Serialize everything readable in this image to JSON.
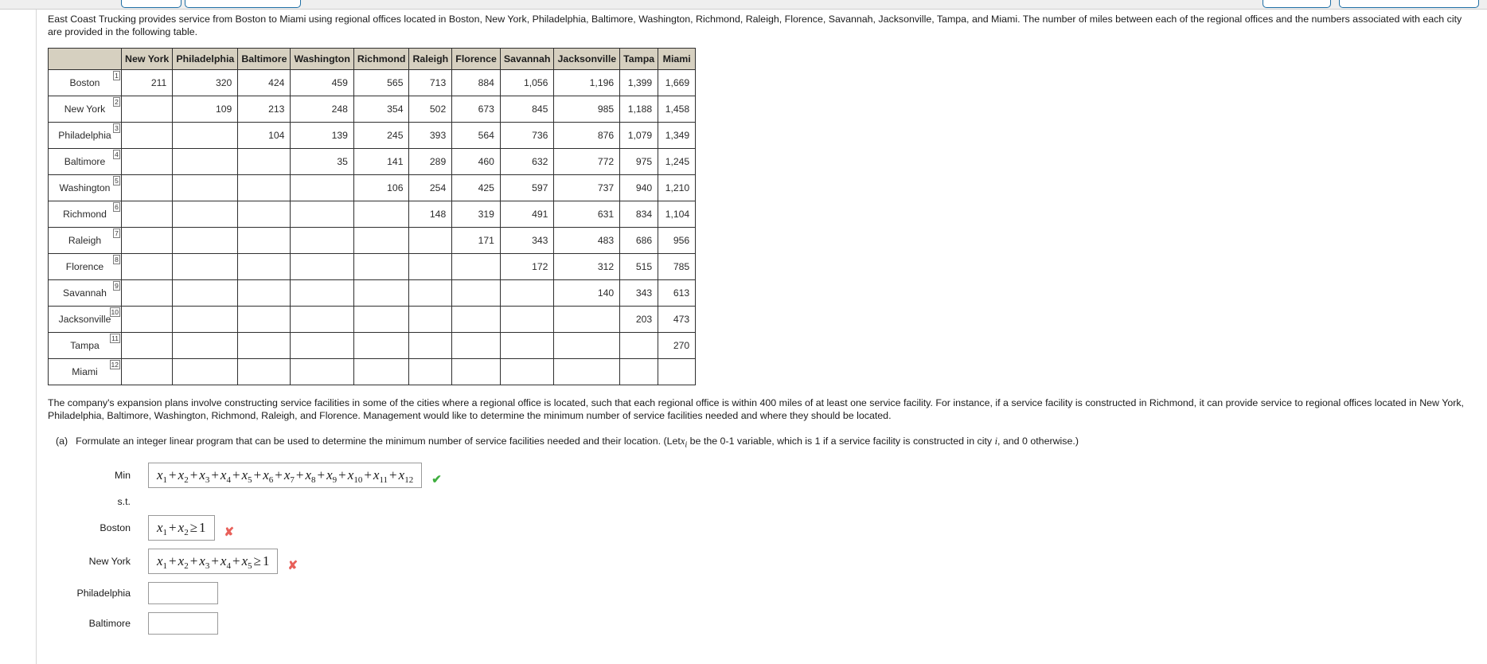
{
  "top_bar": {
    "buttons": [
      {
        "name": "toolbar-button-1",
        "label": ""
      },
      {
        "name": "toolbar-button-2",
        "label": ""
      },
      {
        "name": "toolbar-button-3",
        "label": ""
      },
      {
        "name": "toolbar-button-4",
        "label": ""
      }
    ]
  },
  "intro": {
    "paragraph": "East Coast Trucking provides service from Boston to Miami using regional offices located in Boston, New York, Philadelphia, Baltimore, Washington, Richmond, Raleigh, Florence, Savannah, Jacksonville, Tampa, and Miami. The number of miles between each of the regional offices and the numbers associated with each city are provided in the following table."
  },
  "table": {
    "corner_header": "",
    "columns": [
      "New York",
      "Philadelphia",
      "Baltimore",
      "Washington",
      "Richmond",
      "Raleigh",
      "Florence",
      "Savannah",
      "Jacksonville",
      "Tampa",
      "Miami"
    ],
    "rows": [
      {
        "city": "Boston",
        "index": "1",
        "values": [
          "211",
          "320",
          "424",
          "459",
          "565",
          "713",
          "884",
          "1,056",
          "1,196",
          "1,399",
          "1,669"
        ]
      },
      {
        "city": "New York",
        "index": "2",
        "values": [
          "",
          "109",
          "213",
          "248",
          "354",
          "502",
          "673",
          "845",
          "985",
          "1,188",
          "1,458"
        ]
      },
      {
        "city": "Philadelphia",
        "index": "3",
        "values": [
          "",
          "",
          "104",
          "139",
          "245",
          "393",
          "564",
          "736",
          "876",
          "1,079",
          "1,349"
        ]
      },
      {
        "city": "Baltimore",
        "index": "4",
        "values": [
          "",
          "",
          "",
          "35",
          "141",
          "289",
          "460",
          "632",
          "772",
          "975",
          "1,245"
        ]
      },
      {
        "city": "Washington",
        "index": "5",
        "values": [
          "",
          "",
          "",
          "",
          "106",
          "254",
          "425",
          "597",
          "737",
          "940",
          "1,210"
        ]
      },
      {
        "city": "Richmond",
        "index": "6",
        "values": [
          "",
          "",
          "",
          "",
          "",
          "148",
          "319",
          "491",
          "631",
          "834",
          "1,104"
        ]
      },
      {
        "city": "Raleigh",
        "index": "7",
        "values": [
          "",
          "",
          "",
          "",
          "",
          "",
          "171",
          "343",
          "483",
          "686",
          "956"
        ]
      },
      {
        "city": "Florence",
        "index": "8",
        "values": [
          "",
          "",
          "",
          "",
          "",
          "",
          "",
          "172",
          "312",
          "515",
          "785"
        ]
      },
      {
        "city": "Savannah",
        "index": "9",
        "values": [
          "",
          "",
          "",
          "",
          "",
          "",
          "",
          "",
          "140",
          "343",
          "613"
        ]
      },
      {
        "city": "Jacksonville",
        "index": "10",
        "values": [
          "",
          "",
          "",
          "",
          "",
          "",
          "",
          "",
          "",
          "203",
          "473"
        ]
      },
      {
        "city": "Tampa",
        "index": "11",
        "values": [
          "",
          "",
          "",
          "",
          "",
          "",
          "",
          "",
          "",
          "",
          "270"
        ]
      },
      {
        "city": "Miami",
        "index": "12",
        "values": [
          "",
          "",
          "",
          "",
          "",
          "",
          "",
          "",
          "",
          "",
          ""
        ]
      }
    ]
  },
  "expansion": {
    "paragraph": "The company's expansion plans involve constructing service facilities in some of the cities where a regional office is located, such that each regional office is within 400 miles of at least one service facility. For instance, if a service facility is constructed in Richmond, it can provide service to regional offices located in New York, Philadelphia, Baltimore, Washington, Richmond, Raleigh, and Florence. Management would like to determine the minimum number of service facilities needed and where they should be located."
  },
  "part_a": {
    "marker": "(a)",
    "text_before": "Formulate an integer linear program that can be used to determine the minimum number of service facilities needed and their location. (Let",
    "var_symbol": "x",
    "var_subscript": "i",
    "text_middle": "be the 0-1 variable, which is 1 if a service facility is constructed in city",
    "city_symbol": "i",
    "text_after": ", and 0 otherwise.)"
  },
  "objective": {
    "label": "Min",
    "expression": "x1 + x2 + x3 + x4 + x5 + x6 + x7 + x8 + x9 + x10 + x11 + x12",
    "terms": [
      "1",
      "2",
      "3",
      "4",
      "5",
      "6",
      "7",
      "8",
      "9",
      "10",
      "11",
      "12"
    ],
    "status": "correct",
    "status_glyph": "✔"
  },
  "subject_to_label": "s.t.",
  "constraints": [
    {
      "city": "Boston",
      "filled": true,
      "terms": [
        "1",
        "2"
      ],
      "relation": "≥",
      "rhs": "1",
      "expression": "x1 + x2 ≥ 1",
      "status": "wrong",
      "status_glyph": "✘"
    },
    {
      "city": "New York",
      "filled": true,
      "terms": [
        "1",
        "2",
        "3",
        "4",
        "5"
      ],
      "relation": "≥",
      "rhs": "1",
      "expression": "x1 + x2 + x3 + x4 + x5 ≥ 1",
      "status": "wrong",
      "status_glyph": "✘"
    },
    {
      "city": "Philadelphia",
      "filled": false,
      "terms": [],
      "relation": "",
      "rhs": "",
      "expression": "",
      "status": "none",
      "status_glyph": ""
    },
    {
      "city": "Baltimore",
      "filled": false,
      "terms": [],
      "relation": "",
      "rhs": "",
      "expression": "",
      "status": "none",
      "status_glyph": ""
    }
  ],
  "colors": {
    "header_fill": "#d6d0c0",
    "correct": "#3fae3f",
    "wrong": "#e8605a",
    "border": "#2f2f2f",
    "button_border": "#1f6fa5"
  }
}
